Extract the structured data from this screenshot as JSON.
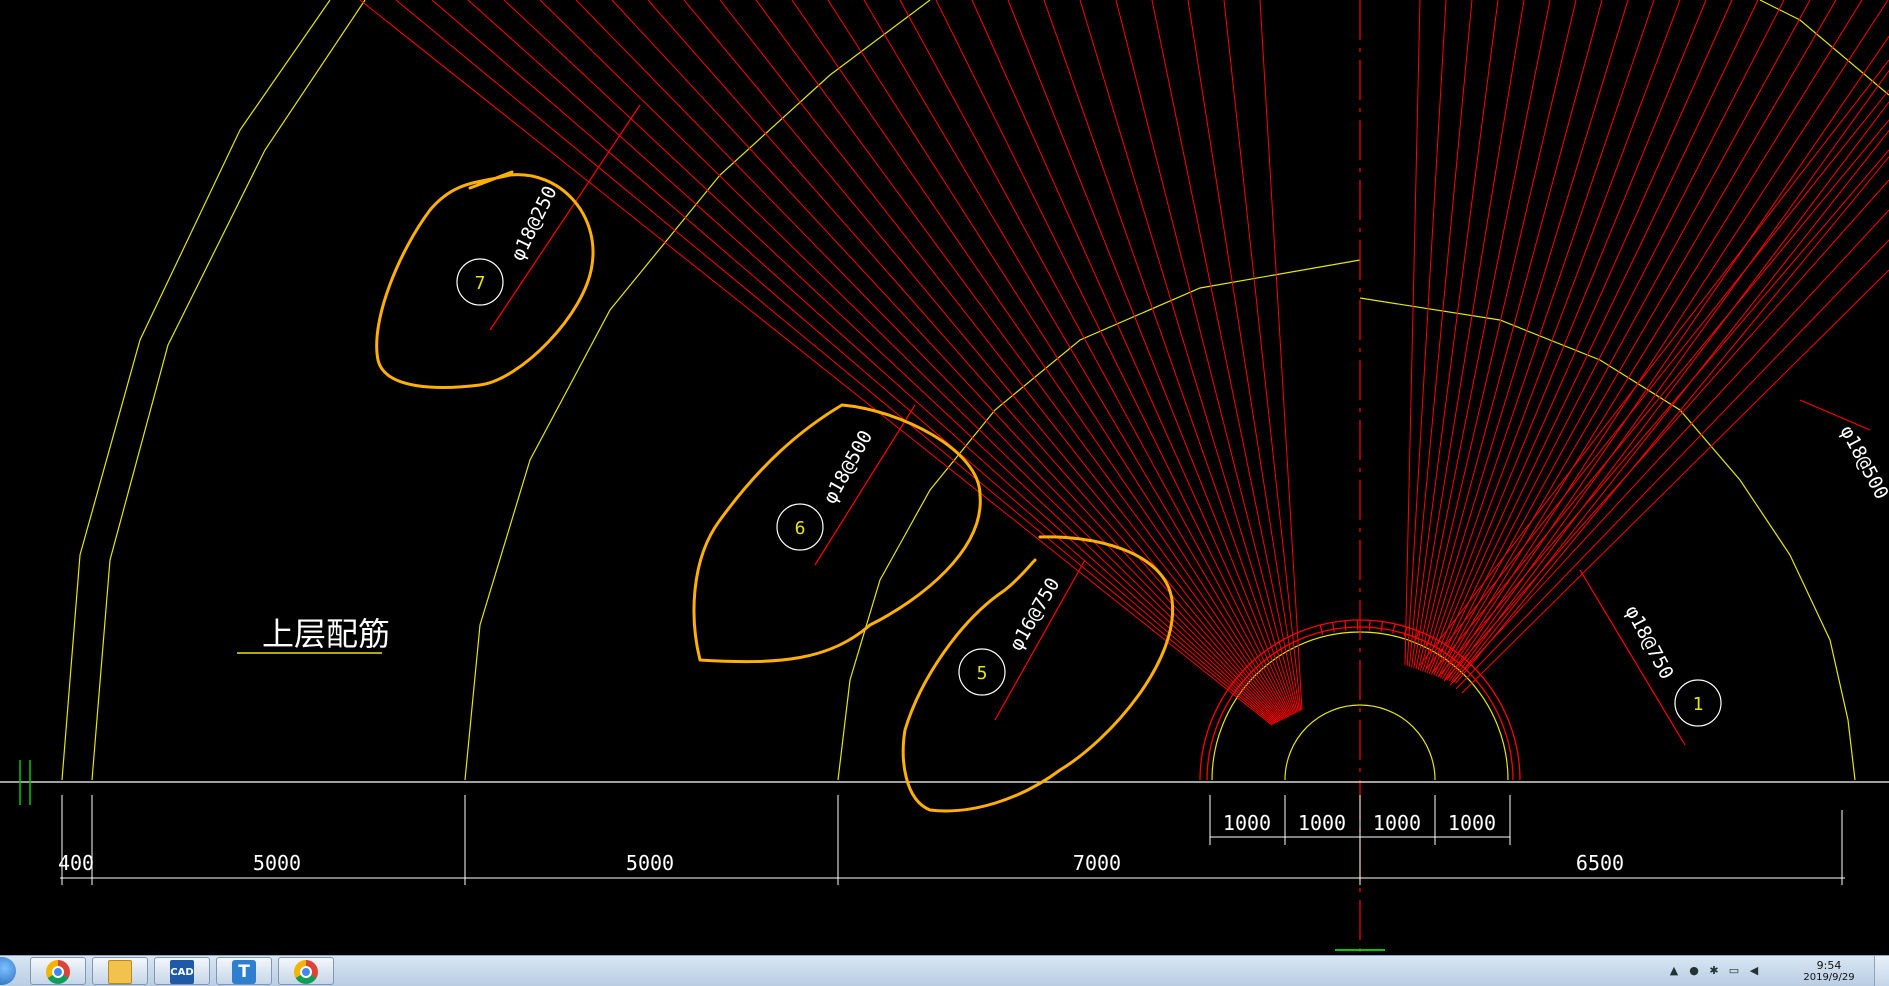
{
  "drawing": {
    "section_title": "上层配筋",
    "rebar_labels": {
      "r7": "φ18@250",
      "r6": "φ18@500",
      "r5": "φ16@750",
      "right_top": "φ18@500",
      "right_mid": "φ18@750"
    },
    "bubbles": {
      "b7": "7",
      "b6": "6",
      "b5": "5",
      "b1": "1"
    },
    "dimensions_upper": [
      "1000",
      "1000",
      "1000",
      "1000"
    ],
    "dimensions_lower": [
      "400",
      "5000",
      "5000",
      "7000",
      "6500"
    ],
    "colors": {
      "background": "#000000",
      "outline": "#e6e600",
      "rebar": "#ff0000",
      "dimension": "#ffffff",
      "markup": "#ffb000",
      "centerline": "#ff0000"
    }
  },
  "taskbar": {
    "apps": [
      {
        "name": "chrome-icon"
      },
      {
        "name": "folder-icon"
      },
      {
        "name": "cad-icon",
        "label": "CAD"
      },
      {
        "name": "t-app-icon",
        "label": "T"
      },
      {
        "name": "chrome-icon"
      }
    ],
    "clock_time": "9:54",
    "clock_date": "2019/9/29"
  }
}
